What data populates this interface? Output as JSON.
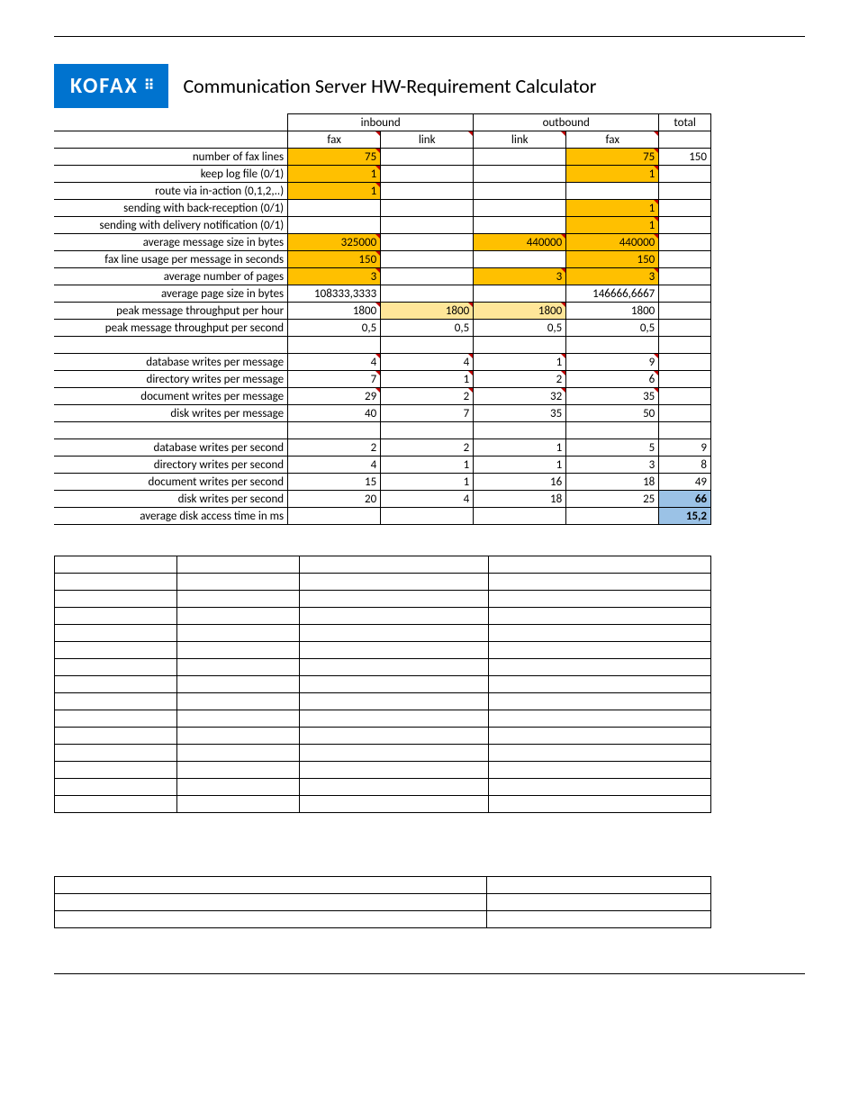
{
  "logo_text": "KOFAX",
  "title": "Communication Server HW-Requirement Calculator",
  "header": {
    "group_inbound": "inbound",
    "group_outbound": "outbound",
    "group_total": "total",
    "col1": "fax",
    "col2": "link",
    "col3": "link",
    "col4": "fax"
  },
  "rows": {
    "r1": {
      "label": "number of fax lines",
      "c1": "75",
      "c4": "75",
      "c5": "150"
    },
    "r2": {
      "label": "keep log file (0/1)",
      "c1": "1",
      "c4": "1"
    },
    "r3": {
      "label": "route via in-action (0,1,2,..)",
      "c1": "1"
    },
    "r4": {
      "label": "sending with back-reception (0/1)",
      "c4": "1"
    },
    "r5": {
      "label": "sending with delivery notification (0/1)",
      "c4": "1"
    },
    "r6": {
      "label": "average message size in bytes",
      "c1": "325000",
      "c3": "440000",
      "c4": "440000"
    },
    "r7": {
      "label": "fax line usage per message in seconds",
      "c1": "150",
      "c4": "150"
    },
    "r8": {
      "label": "average number of pages",
      "c1": "3",
      "c3": "3",
      "c4": "3"
    },
    "r9": {
      "label": "average page size in bytes",
      "c1": "108333,3333",
      "c4": "146666,6667"
    },
    "r10": {
      "label": "peak message throughput per hour",
      "c1": "1800",
      "c2": "1800",
      "c3": "1800",
      "c4": "1800"
    },
    "r11": {
      "label": "peak message throughput per second",
      "c1": "0,5",
      "c2": "0,5",
      "c3": "0,5",
      "c4": "0,5"
    },
    "r12": {
      "label": "database writes per message",
      "c1": "4",
      "c2": "4",
      "c3": "1",
      "c4": "9"
    },
    "r13": {
      "label": "directory writes per message",
      "c1": "7",
      "c2": "1",
      "c3": "2",
      "c4": "6"
    },
    "r14": {
      "label": "document writes per message",
      "c1": "29",
      "c2": "2",
      "c3": "32",
      "c4": "35"
    },
    "r15": {
      "label": "disk writes per message",
      "c1": "40",
      "c2": "7",
      "c3": "35",
      "c4": "50"
    },
    "r16": {
      "label": "database writes per second",
      "c1": "2",
      "c2": "2",
      "c3": "1",
      "c4": "5",
      "c5": "9"
    },
    "r17": {
      "label": "directory writes per second",
      "c1": "4",
      "c2": "1",
      "c3": "1",
      "c4": "3",
      "c5": "8"
    },
    "r18": {
      "label": "document writes per second",
      "c1": "15",
      "c2": "1",
      "c3": "16",
      "c4": "18",
      "c5": "49"
    },
    "r19": {
      "label": "disk writes per second",
      "c1": "20",
      "c2": "4",
      "c3": "18",
      "c4": "25",
      "c5": "66"
    },
    "r20": {
      "label": "average disk access time in ms",
      "c5": "15,2"
    }
  }
}
